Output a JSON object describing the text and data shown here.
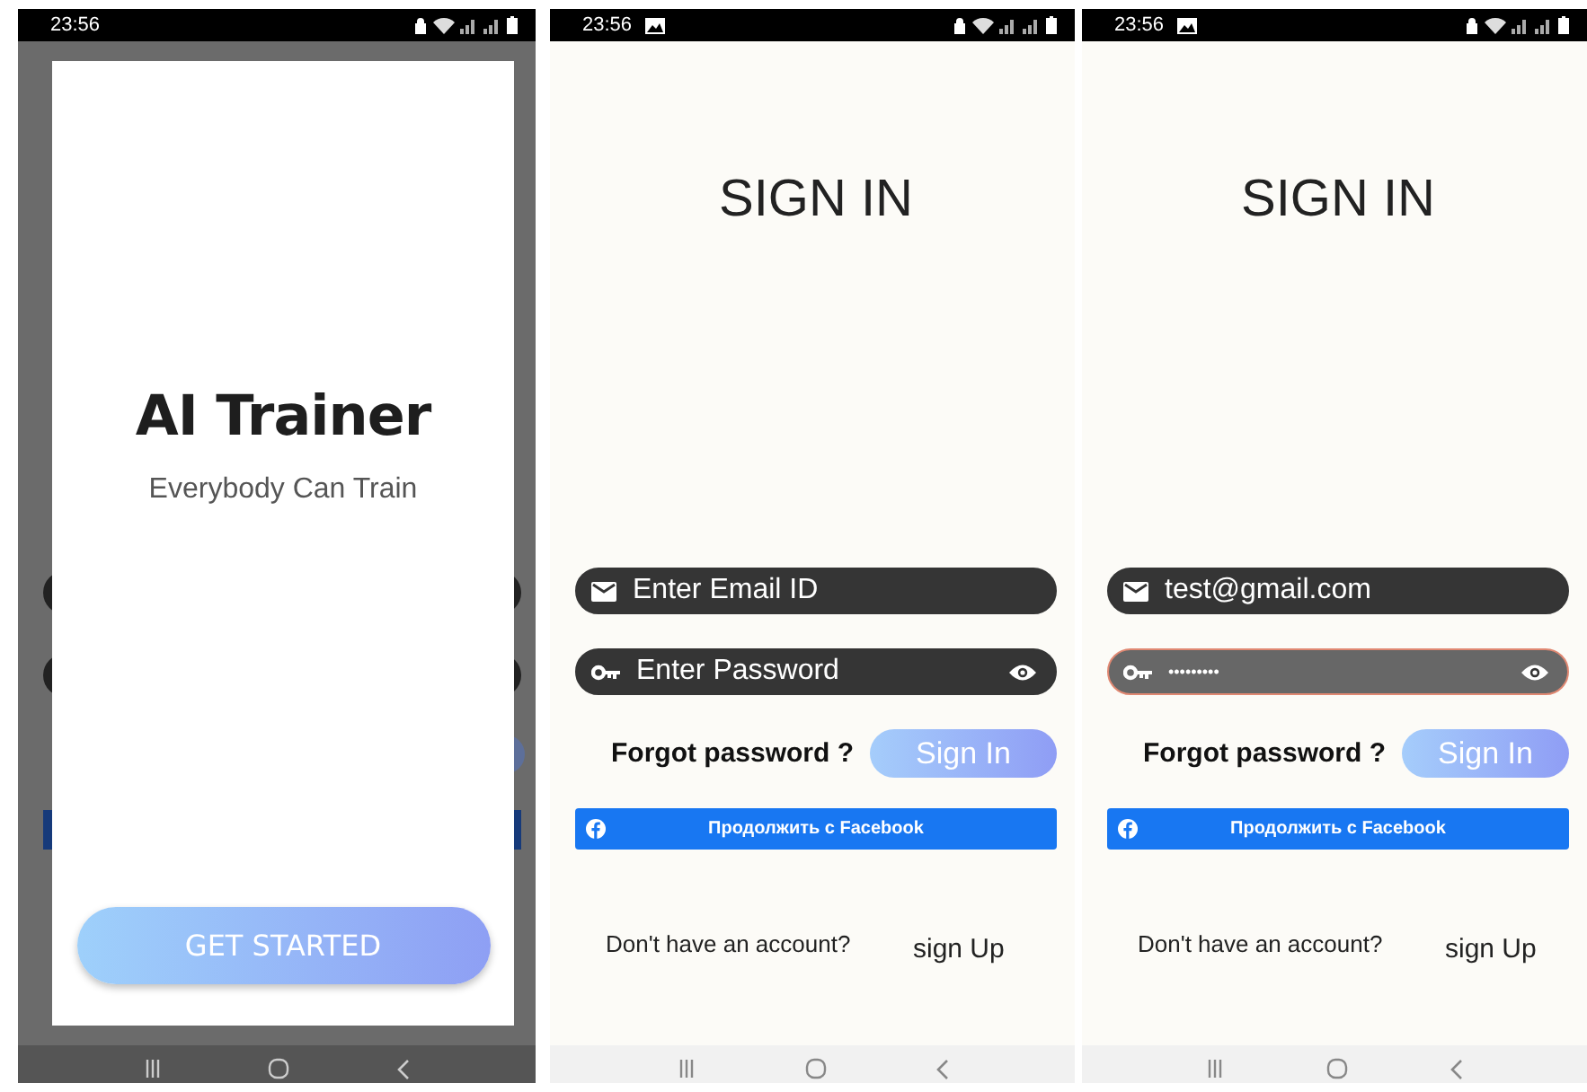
{
  "screens": [
    {
      "kind": "splash",
      "status_bar": {
        "time": "23:56",
        "image_notification": false
      },
      "title": "AI Trainer",
      "subtitle": "Everybody Can Train",
      "button": "GET STARTED"
    },
    {
      "kind": "signin",
      "status_bar": {
        "time": "23:56",
        "image_notification": true
      },
      "heading": "SIGN IN",
      "email": {
        "placeholder": "Enter Email ID"
      },
      "password": {
        "placeholder": "Enter Password",
        "focused": false
      },
      "forgot": "Forgot password ?",
      "sign_in": "Sign In",
      "facebook": "Продолжить с Facebook",
      "no_account": "Don't have an account?",
      "sign_up": "sign Up"
    },
    {
      "kind": "signin",
      "status_bar": {
        "time": "23:56",
        "image_notification": true
      },
      "heading": "SIGN IN",
      "email": {
        "value": "test@gmail.com"
      },
      "password": {
        "value": "•••••••••",
        "focused": true
      },
      "forgot": "Forgot password ?",
      "sign_in": "Sign In",
      "facebook": "Продолжить с Facebook",
      "no_account": "Don't have an account?",
      "sign_up": "sign Up"
    }
  ]
}
